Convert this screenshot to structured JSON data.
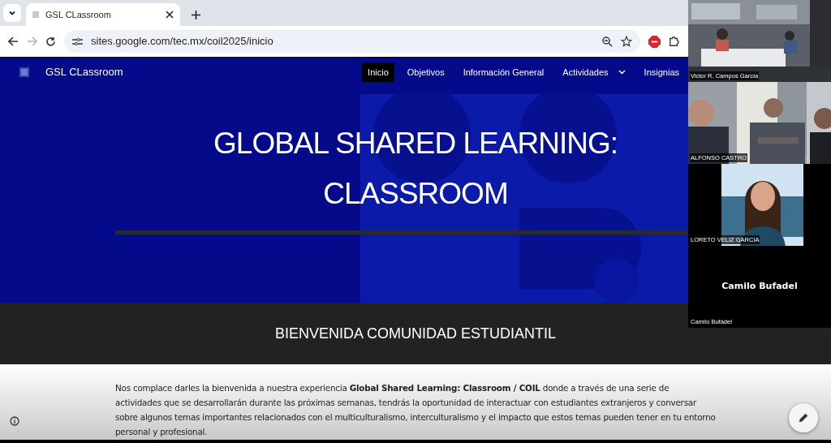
{
  "browser": {
    "tab_title": "GSL CLassroom",
    "address": "sites.google.com/tec.mx/coil2025/inicio",
    "forward_disabled": true
  },
  "site": {
    "name": "GSL CLassroom",
    "nav": [
      {
        "label": "Inicio",
        "selected": true
      },
      {
        "label": "Objetivos",
        "selected": false
      },
      {
        "label": "Información General",
        "selected": false
      },
      {
        "label": "Actividades",
        "selected": false,
        "has_menu": true
      },
      {
        "label": "Insignias",
        "selected": false
      }
    ],
    "hero_title": "GLOBAL SHARED LEARNING: CLASSROOM",
    "banner": "BIENVENIDA COMUNIDAD ESTUDIANTIL",
    "intro": "Nos complace darles la bienvenida a nuestra experiencia **Global Shared Learning: Classroom / COIL** donde a través de una serie de actividades que se desarrollarán durante las próximas semanas, tendrás la oportunidad de interactuar con estudiantes extranjeros y conversar sobre algunos temas importantes relacionados con el multiculturalismo, interculturalismo y el impacto que estos temas pueden tener en tu entorno personal y profesional."
  },
  "call": {
    "participants": [
      {
        "name": "Victor R. Campos García",
        "kind": "room"
      },
      {
        "name": "ALFONSO CASTRO",
        "kind": "group"
      },
      {
        "name": "LORETO VELIZ GARCIA",
        "kind": "portrait"
      },
      {
        "name": "Camilo Bufadel",
        "kind": "avatar",
        "display_name": "Camilo Bufadel"
      }
    ]
  }
}
